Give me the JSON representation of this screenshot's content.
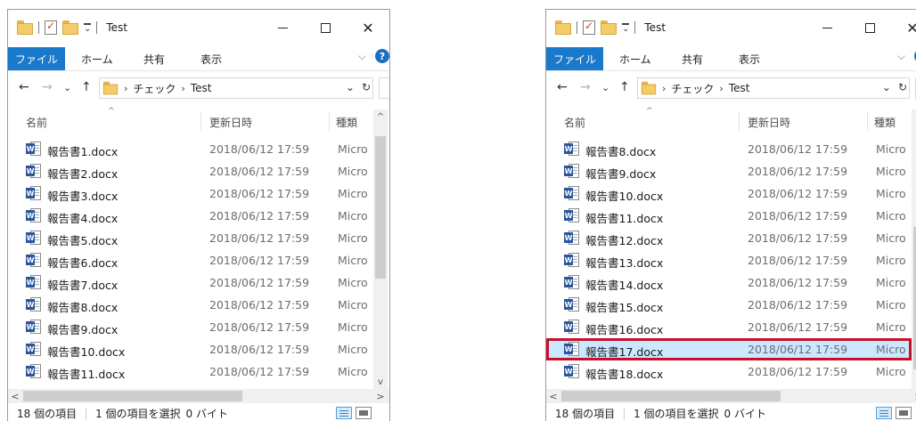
{
  "window": {
    "title": "Test",
    "help_glyph": "?",
    "minimize_icon": "minimize-icon",
    "maximize_icon": "maximize-icon",
    "close_glyph": "✕"
  },
  "ribbon": {
    "file_tab": "ファイル",
    "tabs": [
      "ホーム",
      "共有",
      "表示"
    ],
    "collapse_glyph": "⌵"
  },
  "nav": {
    "back_glyph": "←",
    "forward_glyph": "→",
    "recent_glyph": "⌄",
    "up_glyph": "↑",
    "dropdown_glyph": "⌄",
    "refresh_glyph": "↻"
  },
  "address": {
    "separator": "›",
    "crumbs": [
      "チェック",
      "Test"
    ]
  },
  "columns": {
    "name": "名前",
    "date": "更新日時",
    "type": "種類",
    "sort_glyph": "^"
  },
  "scroll": {
    "up_glyph": "▲",
    "down_glyph": "▼",
    "left_glyph": "<",
    "right_glyph": ">",
    "left_up_glyph": "^",
    "left_down_glyph": "v"
  },
  "left_view": {
    "files": [
      {
        "name": "報告書1.docx",
        "date": "2018/06/12 17:59",
        "type": "Micro"
      },
      {
        "name": "報告書2.docx",
        "date": "2018/06/12 17:59",
        "type": "Micro"
      },
      {
        "name": "報告書3.docx",
        "date": "2018/06/12 17:59",
        "type": "Micro"
      },
      {
        "name": "報告書4.docx",
        "date": "2018/06/12 17:59",
        "type": "Micro"
      },
      {
        "name": "報告書5.docx",
        "date": "2018/06/12 17:59",
        "type": "Micro"
      },
      {
        "name": "報告書6.docx",
        "date": "2018/06/12 17:59",
        "type": "Micro"
      },
      {
        "name": "報告書7.docx",
        "date": "2018/06/12 17:59",
        "type": "Micro"
      },
      {
        "name": "報告書8.docx",
        "date": "2018/06/12 17:59",
        "type": "Micro"
      },
      {
        "name": "報告書9.docx",
        "date": "2018/06/12 17:59",
        "type": "Micro"
      },
      {
        "name": "報告書10.docx",
        "date": "2018/06/12 17:59",
        "type": "Micro"
      },
      {
        "name": "報告書11.docx",
        "date": "2018/06/12 17:59",
        "type": "Micro"
      }
    ]
  },
  "right_view": {
    "files": [
      {
        "name": "報告書8.docx",
        "date": "2018/06/12 17:59",
        "type": "Micro"
      },
      {
        "name": "報告書9.docx",
        "date": "2018/06/12 17:59",
        "type": "Micro"
      },
      {
        "name": "報告書10.docx",
        "date": "2018/06/12 17:59",
        "type": "Micro"
      },
      {
        "name": "報告書11.docx",
        "date": "2018/06/12 17:59",
        "type": "Micro"
      },
      {
        "name": "報告書12.docx",
        "date": "2018/06/12 17:59",
        "type": "Micro"
      },
      {
        "name": "報告書13.docx",
        "date": "2018/06/12 17:59",
        "type": "Micro"
      },
      {
        "name": "報告書14.docx",
        "date": "2018/06/12 17:59",
        "type": "Micro"
      },
      {
        "name": "報告書15.docx",
        "date": "2018/06/12 17:59",
        "type": "Micro"
      },
      {
        "name": "報告書16.docx",
        "date": "2018/06/12 17:59",
        "type": "Micro"
      },
      {
        "name": "報告書17.docx",
        "date": "2018/06/12 17:59",
        "type": "Micro"
      },
      {
        "name": "報告書18.docx",
        "date": "2018/06/12 17:59",
        "type": "Micro"
      }
    ],
    "selected_index": 9
  },
  "status": {
    "item_count": "18 個の項目",
    "selection": "1 個の項目を選択",
    "size": "0 バイト"
  },
  "colors": {
    "accent": "#1979ca",
    "selection_fill": "#cce8ff",
    "highlight_border": "#c8102e",
    "word_blue": "#2b579a"
  },
  "icons": {
    "file_icon": "word-document-icon",
    "folder_icon": "folder-icon"
  }
}
